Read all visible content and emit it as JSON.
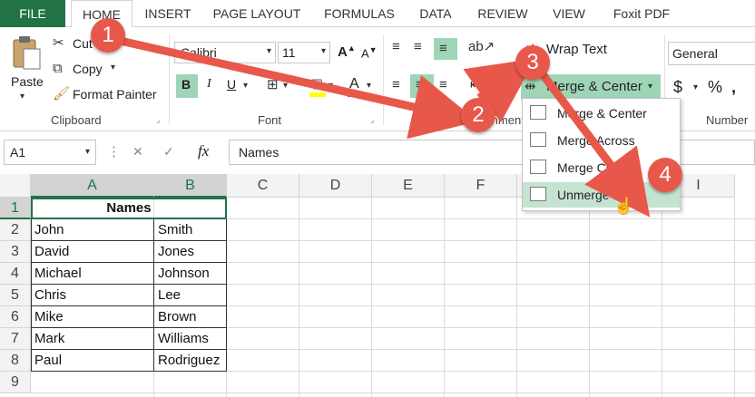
{
  "tabs": [
    "FILE",
    "HOME",
    "INSERT",
    "PAGE LAYOUT",
    "FORMULAS",
    "DATA",
    "REVIEW",
    "VIEW",
    "Foxit PDF"
  ],
  "clipboard": {
    "paste": "Paste",
    "cut": "Cut",
    "copy": "Copy",
    "format_painter": "Format Painter",
    "group_label": "Clipboard"
  },
  "font": {
    "name": "Calibri",
    "size": "11",
    "group_label": "Font",
    "bold": "B",
    "italic": "I",
    "underline": "U"
  },
  "alignment": {
    "wrap_text": "Wrap Text",
    "merge_center": "Merge & Center",
    "group_label": "Alignment"
  },
  "number": {
    "format": "General",
    "currency": "$",
    "percent": "%",
    "group_label": "Number"
  },
  "formula_bar": {
    "name_box": "A1",
    "cancel": "✕",
    "enter": "✓",
    "fx": "fx",
    "value": "Names"
  },
  "merge_menu": [
    "Merge & Center",
    "Merge Across",
    "Merge Cells",
    "Unmerge Cells"
  ],
  "columns": [
    "A",
    "B",
    "C",
    "D",
    "E",
    "F",
    "G",
    "H",
    "I"
  ],
  "rows": [
    "1",
    "2",
    "3",
    "4",
    "5",
    "6",
    "7",
    "8",
    "9"
  ],
  "header_cell": "Names",
  "data_rows": [
    [
      "John",
      "Smith"
    ],
    [
      "David",
      "Jones"
    ],
    [
      "Michael",
      "Johnson"
    ],
    [
      "Chris",
      "Lee"
    ],
    [
      "Mike",
      "Brown"
    ],
    [
      "Mark",
      "Williams"
    ],
    [
      "Paul",
      "Rodriguez"
    ]
  ],
  "callouts": [
    "1",
    "2",
    "3",
    "4"
  ],
  "colors": {
    "excel_green": "#217346",
    "highlight": "#9fd5b7",
    "arrow_red": "#e8584a"
  }
}
